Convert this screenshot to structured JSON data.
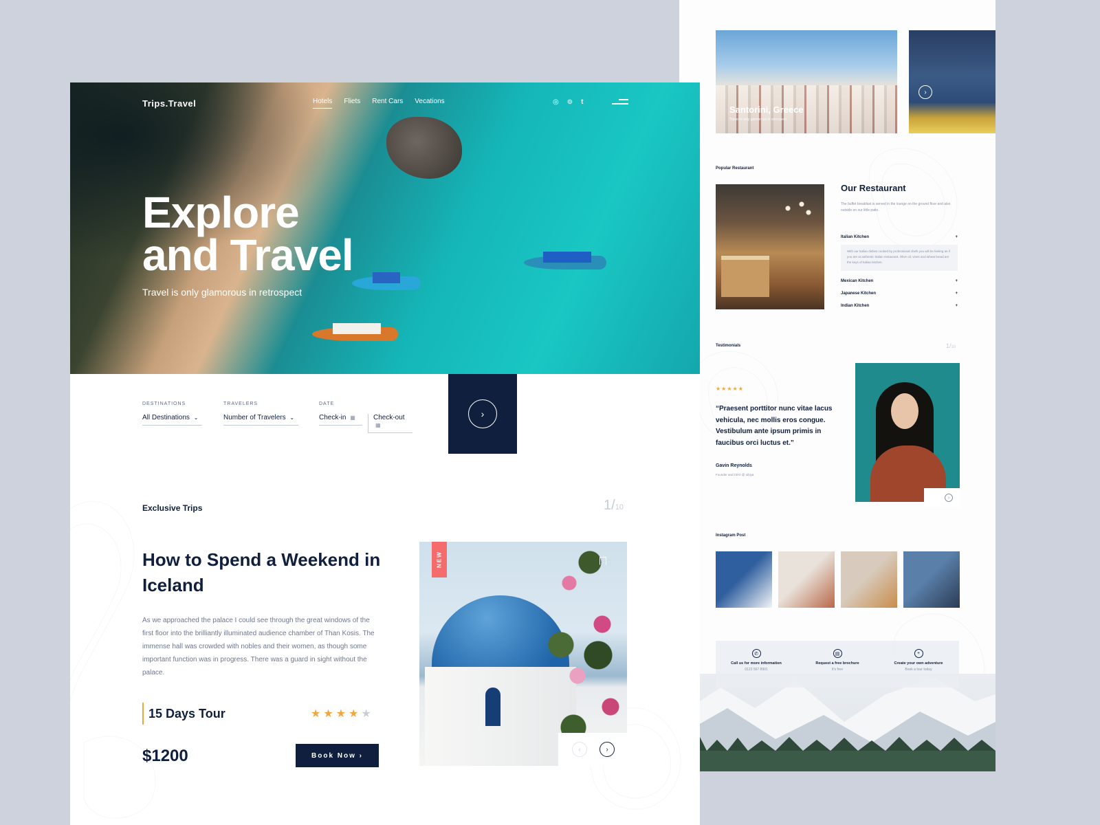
{
  "right_page": {
    "featured": {
      "title": "Santorini, Greece",
      "subtitle": "Travel is only glamorous in retrospect",
      "next_icon": "chevron-right-icon"
    },
    "restaurant": {
      "section_label": "Popular Restaurant",
      "title": "Our Restaurant",
      "description": "The buffet breakfast is served in the lounge on the ground floor and also outside on our little patio.",
      "kitchens": [
        {
          "label": "Italian Kitchen",
          "toggle": "+",
          "expanded_text": "With our Italian dishes cooked by professional chefs you will be feeling as if you are at authentic Italian restaurant. Olive oil, vines and wheat bread are the keys of Italian kitchen."
        },
        {
          "label": "Mexican Kitchen",
          "toggle": "+"
        },
        {
          "label": "Japanese Kitchen",
          "toggle": "+"
        },
        {
          "label": "Indian Kitchen",
          "toggle": "+"
        }
      ]
    },
    "testimonials": {
      "section_label": "Testimonials",
      "counter_current": "1/",
      "counter_total": "10",
      "stars": "★★★★★",
      "quote": "“Praesent porttitor nunc vitae lacus vehicula, nec mollis eros congue. Vestibulum ante ipsum primis in faucibus orci luctus et.”",
      "name": "Gavin Reynolds",
      "role": "Founder and CEO @ uihiya"
    },
    "instagram": {
      "section_label": "Instagram Post",
      "posts": [
        {
          "name": "instagram-post-1",
          "colors": [
            "#2f5f9e",
            "#f2f4f6"
          ]
        },
        {
          "name": "instagram-post-2",
          "colors": [
            "#e9e2da",
            "#b9684a"
          ]
        },
        {
          "name": "instagram-post-3",
          "colors": [
            "#d8cbbd",
            "#c98d4c"
          ]
        },
        {
          "name": "instagram-post-4",
          "colors": [
            "#5a7fa8",
            "#2b3b55"
          ]
        }
      ]
    },
    "contacts": [
      {
        "icon": "phone-icon",
        "glyph": "✆",
        "title": "Call us for more information",
        "subtitle": "0123 567 8901"
      },
      {
        "icon": "brochure-icon",
        "glyph": "▤",
        "title": "Request a free brochure",
        "subtitle": "It's free"
      },
      {
        "icon": "plus-circle-icon",
        "glyph": "+",
        "title": "Create your own adventure",
        "subtitle": "Book a tour today"
      }
    ]
  },
  "main_page": {
    "brand": "Trips.Travel",
    "nav": [
      {
        "label": "Hotels",
        "active": true
      },
      {
        "label": "Fliets",
        "active": false
      },
      {
        "label": "Rent Cars",
        "active": false
      },
      {
        "label": "Vecations",
        "active": false
      }
    ],
    "socials": [
      {
        "icon": "instagram-icon",
        "glyph": "◎"
      },
      {
        "icon": "tripadvisor-icon",
        "glyph": "⊚"
      },
      {
        "icon": "tumblr-icon",
        "glyph": "t"
      }
    ],
    "menu_icon": "hamburger-menu-icon",
    "hero": {
      "title_line1": "Explore",
      "title_line2": "and Travel",
      "subtitle": "Travel is only glamorous in retrospect"
    },
    "search": {
      "destinations_label": "DESTINATIONS",
      "destinations_value": "All Destinations",
      "travelers_label": "TRAVELERS",
      "travelers_value": "Number of Travelers",
      "date_label": "DATE",
      "checkin_value": "Check-in",
      "checkout_value": "Check-out",
      "submit_icon": "chevron-right-icon"
    },
    "trips": {
      "section_title": "Exclusive Trips",
      "counter_current": "1/",
      "counter_total": "10",
      "heading": "How to Spend a Weekend in Iceland",
      "description": "As we approached the palace I could see through the great windows of the first floor into the brilliantly illuminated audience chamber of Than Kosis. The immense hall was crowded with nobles and their women, as though some important function was in progress. There was a guard in sight without the palace.",
      "duration": "15 Days Tour",
      "rating_value": 4,
      "rating_max": 5,
      "price": "$1200",
      "book_label": "Book Now  ›",
      "badge": "NEW",
      "prev_icon": "chevron-left-icon",
      "next_icon": "chevron-right-icon"
    }
  },
  "colors": {
    "navy": "#0f1f3d",
    "accent": "#f2a53b",
    "badge": "#f46c6c",
    "muted": "#c6ccd8"
  }
}
